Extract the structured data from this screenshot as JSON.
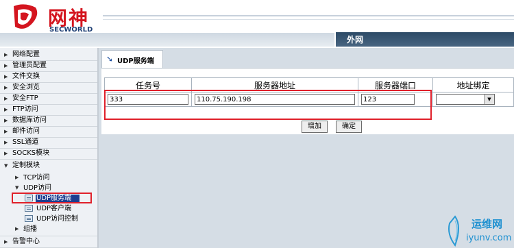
{
  "header": {
    "brand_cn": "网神",
    "brand_en": "SECWORLD",
    "net_tab": "外网"
  },
  "sidebar": {
    "items": [
      {
        "label": "网络配置"
      },
      {
        "label": "管理员配置"
      },
      {
        "label": "文件交换"
      },
      {
        "label": "安全浏览"
      },
      {
        "label": "安全FTP"
      },
      {
        "label": "FTP访问"
      },
      {
        "label": "数据库访问"
      },
      {
        "label": "邮件访问"
      },
      {
        "label": "SSL通道"
      },
      {
        "label": "SOCKS模块"
      },
      {
        "label": "定制模块"
      }
    ],
    "sub": {
      "tcp": "TCP访问",
      "udp": "UDP访问",
      "udp_server": "UDP服务端",
      "udp_client": "UDP客户端",
      "udp_control": "UDP访问控制",
      "group": "组播"
    },
    "alert": "告警中心"
  },
  "main": {
    "tab_label": "UDP服务端",
    "table": {
      "headers": [
        "任务号",
        "服务器地址",
        "服务器端口",
        "地址绑定"
      ],
      "row": {
        "task_no": "333",
        "server_addr": "110.75.190.198",
        "server_port": "123",
        "bind": ""
      }
    },
    "buttons": {
      "add": "增加",
      "confirm": "确定"
    }
  },
  "watermark": {
    "line1": "运维网",
    "line2": "iyunv.com"
  },
  "colors": {
    "accent": "#e0202a",
    "header_dark": "#2c4a66",
    "panel_bg": "#d5dde5"
  }
}
